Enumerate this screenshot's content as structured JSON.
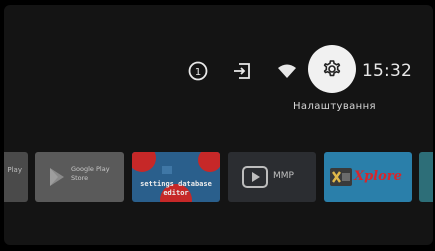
{
  "status_bar": {
    "icons": [
      "notification-count-icon",
      "input-source-icon",
      "wifi-icon",
      "settings-icon"
    ],
    "notification_count": "1",
    "clock": "15:32",
    "focused_tooltip": "Налаштування"
  },
  "apps_row": {
    "items": [
      {
        "name": "partial-play",
        "label": "Play"
      },
      {
        "name": "google-play-store",
        "label_line1": "Google Play",
        "label_line2": "Store"
      },
      {
        "name": "settings-database-editor",
        "label_line1": "settings database",
        "label_line2": "editor"
      },
      {
        "name": "mmp",
        "label": "MMP"
      },
      {
        "name": "xplore",
        "label": "Xplore"
      },
      {
        "name": "partial-next",
        "label": ""
      }
    ]
  },
  "colors": {
    "background": "#000000",
    "screen": "#141414",
    "focused_circle": "#f1f1f1",
    "xplore_text": "#d7262b"
  }
}
